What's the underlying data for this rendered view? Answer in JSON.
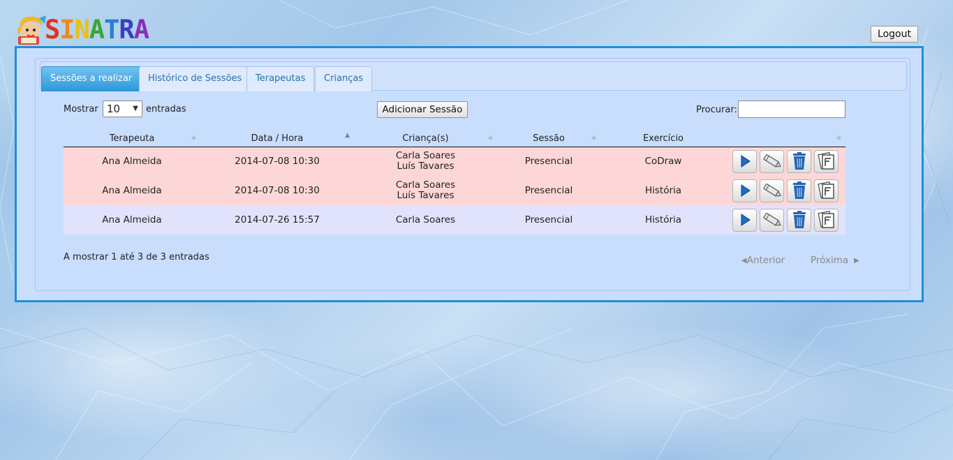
{
  "app": {
    "logo_text": "SINATRA"
  },
  "header": {
    "logout_label": "Logout"
  },
  "tabs": [
    {
      "label": "Sessões a realizar",
      "active": true
    },
    {
      "label": "Histórico de Sessões",
      "active": false
    },
    {
      "label": "Terapeutas",
      "active": false
    },
    {
      "label": "Crianças",
      "active": false
    }
  ],
  "controls": {
    "show_label": "Mostrar",
    "page_length_selected": "10",
    "entries_label": "entradas",
    "add_session_label": "Adicionar Sessão",
    "search_label": "Procurar:",
    "search_value": ""
  },
  "table": {
    "columns": [
      "Terapeuta",
      "Data / Hora",
      "Criança(s)",
      "Sessão",
      "Exercício",
      ""
    ],
    "sorted_column": "Data / Hora",
    "rows": [
      {
        "terapeuta": "Ana Almeida",
        "data_hora": "2014-07-08 10:30",
        "criancas": [
          "Carla Soares",
          "Luís Tavares"
        ],
        "sessao": "Presencial",
        "exercicio": "CoDraw",
        "highlight": "red"
      },
      {
        "terapeuta": "Ana Almeida",
        "data_hora": "2014-07-08 10:30",
        "criancas": [
          "Carla Soares",
          "Luís Tavares"
        ],
        "sessao": "Presencial",
        "exercicio": "História",
        "highlight": "red"
      },
      {
        "terapeuta": "Ana Almeida",
        "data_hora": "2014-07-26 15:57",
        "criancas": [
          "Carla Soares"
        ],
        "sessao": "Presencial",
        "exercicio": "História",
        "highlight": "blue"
      }
    ],
    "row_actions": [
      "play-icon",
      "edit-icon",
      "trash-icon",
      "notes-icon"
    ]
  },
  "footer": {
    "info": "A mostrar 1 até 3 de 3 entradas",
    "previous_label": "Anterior",
    "next_label": "Próxima"
  },
  "colors": {
    "frame_border": "#1d8fd8",
    "panel_bg": "#c9defd",
    "active_tab": "#2d97d9",
    "row_red": "#fdd7d7",
    "row_blue": "#e1e3fd",
    "play_blue": "#1b6fc4",
    "trash_blue": "#2763b3"
  }
}
